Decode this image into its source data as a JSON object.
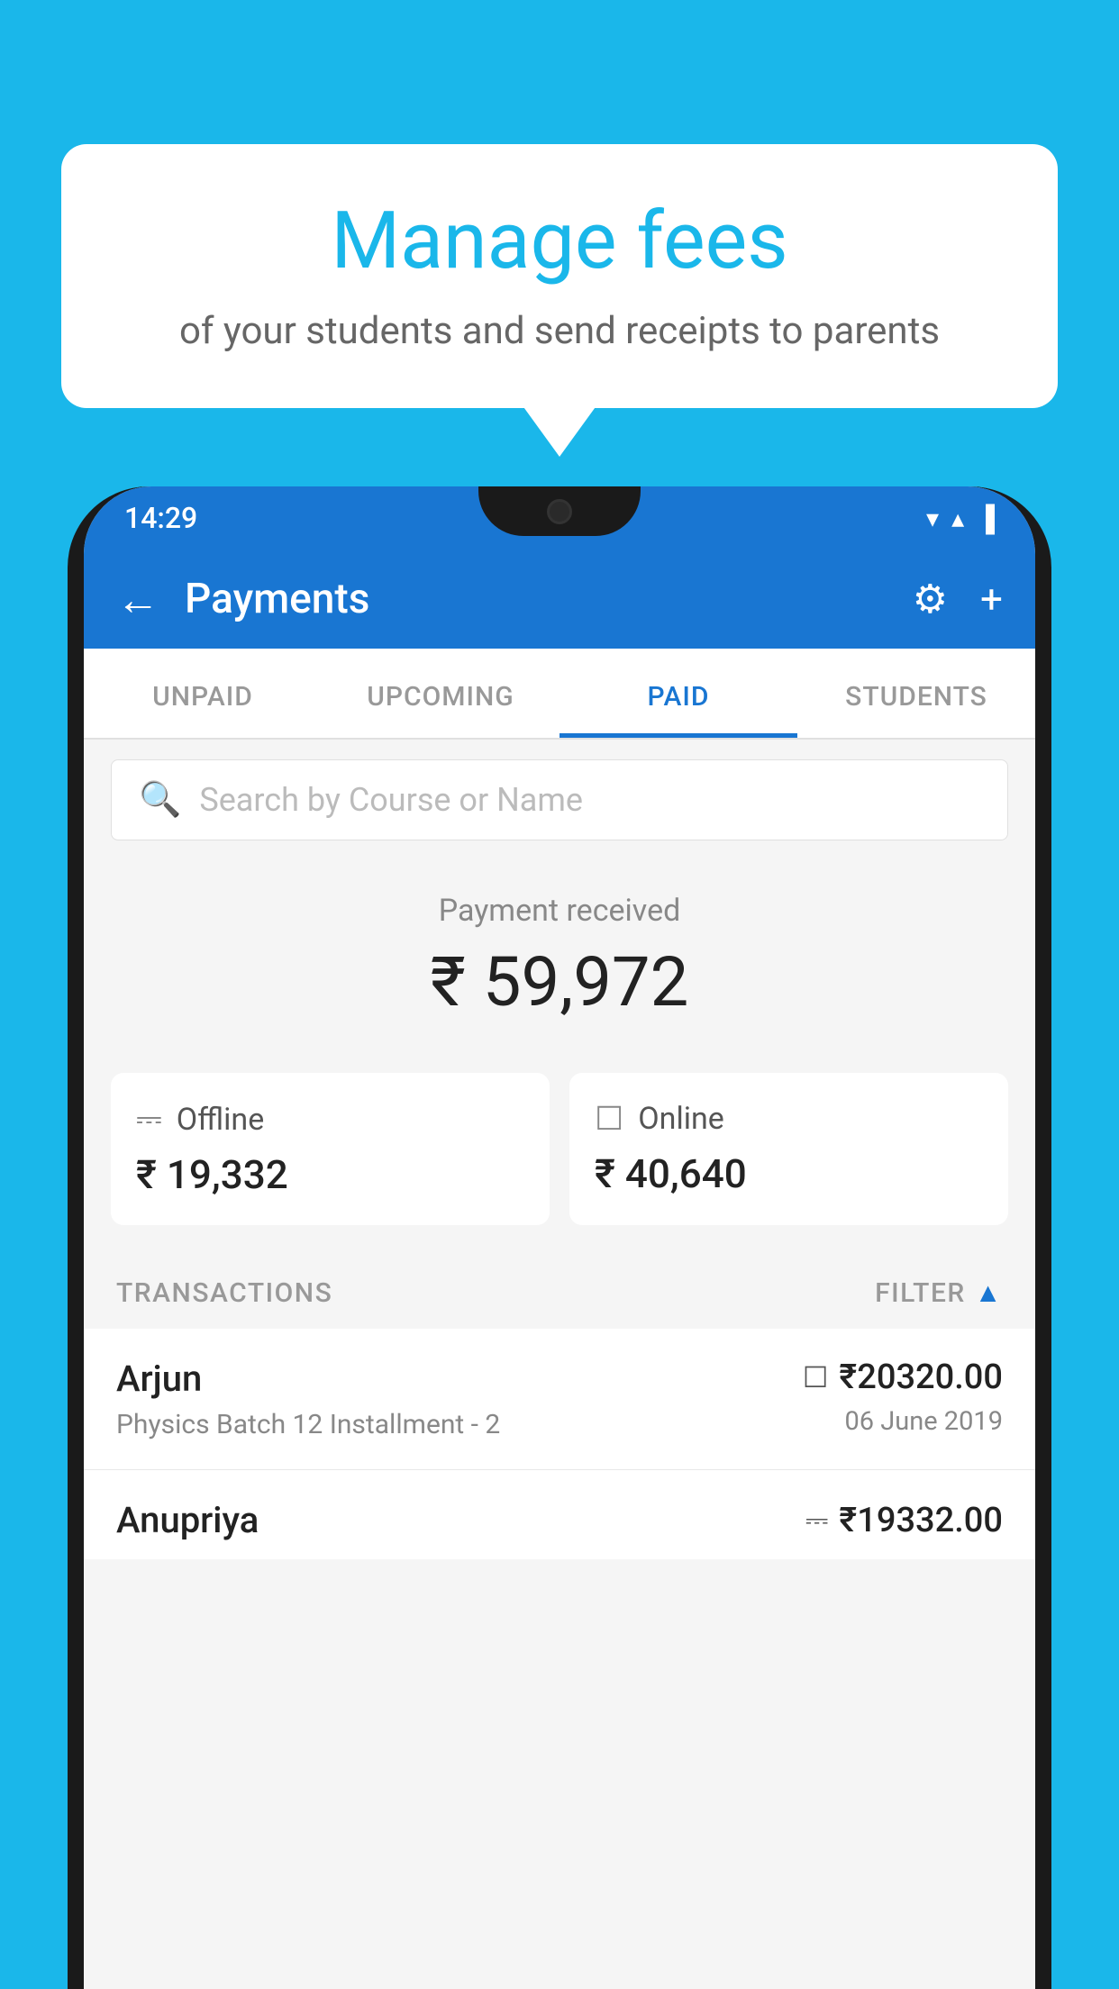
{
  "background_color": "#1ab7ea",
  "speech_bubble": {
    "title": "Manage fees",
    "subtitle": "of your students and send receipts to parents"
  },
  "status_bar": {
    "time": "14:29",
    "wifi_icon": "▼",
    "signal_icon": "▲",
    "battery_icon": "▐"
  },
  "app_bar": {
    "title": "Payments",
    "back_icon": "←",
    "settings_icon": "⚙",
    "add_icon": "+"
  },
  "tabs": [
    {
      "label": "UNPAID",
      "active": false
    },
    {
      "label": "UPCOMING",
      "active": false
    },
    {
      "label": "PAID",
      "active": true
    },
    {
      "label": "STUDENTS",
      "active": false
    }
  ],
  "search": {
    "placeholder": "Search by Course or Name"
  },
  "payment_received": {
    "label": "Payment received",
    "amount": "₹ 59,972",
    "offline": {
      "type": "Offline",
      "amount": "₹ 19,332"
    },
    "online": {
      "type": "Online",
      "amount": "₹ 40,640"
    }
  },
  "transactions": {
    "label": "TRANSACTIONS",
    "filter_label": "FILTER",
    "items": [
      {
        "name": "Arjun",
        "course": "Physics Batch 12 Installment - 2",
        "payment_method": "card",
        "amount": "₹20320.00",
        "date": "06 June 2019"
      },
      {
        "name": "Anupriya",
        "course": "",
        "payment_method": "offline",
        "amount": "₹19332.00",
        "date": ""
      }
    ]
  }
}
